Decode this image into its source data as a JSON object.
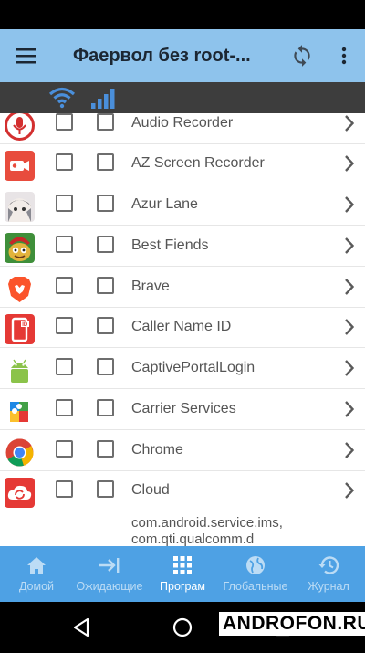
{
  "app_bar": {
    "title": "Фаервол без root-...",
    "menu_icon": "hamburger-icon",
    "refresh_icon": "refresh-icon",
    "more_icon": "more-vert-icon",
    "background": "#8ec3ec"
  },
  "filter_bar": {
    "wifi_icon": "wifi-icon",
    "mobile_icon": "cellular-signal-icon",
    "icon_color": "#4a8fdb"
  },
  "apps": [
    {
      "name": "Audio Recorder",
      "icon": "microphone-icon",
      "wifi": false,
      "mobile": false
    },
    {
      "name": "AZ Screen Recorder",
      "icon": "video-camera-icon",
      "wifi": false,
      "mobile": false
    },
    {
      "name": "Azur Lane",
      "icon": "anime-character-icon",
      "wifi": false,
      "mobile": false
    },
    {
      "name": "Best Fiends",
      "icon": "best-fiends-icon",
      "wifi": false,
      "mobile": false
    },
    {
      "name": "Brave",
      "icon": "brave-lion-icon",
      "wifi": false,
      "mobile": false
    },
    {
      "name": "Caller Name ID",
      "icon": "phone-id-icon",
      "wifi": false,
      "mobile": false
    },
    {
      "name": "CaptivePortalLogin",
      "icon": "android-robot-icon",
      "wifi": false,
      "mobile": false
    },
    {
      "name": "Carrier Services",
      "icon": "puzzle-icon",
      "wifi": false,
      "mobile": false
    },
    {
      "name": "Chrome",
      "icon": "chrome-icon",
      "wifi": false,
      "mobile": false
    },
    {
      "name": "Cloud",
      "icon": "cloud-sync-icon",
      "wifi": false,
      "mobile": false
    }
  ],
  "system_entry": {
    "line1": "com.android.service.ims,",
    "line2": "com.qti.qualcomm.d"
  },
  "bottom_nav": [
    {
      "label": "Домой",
      "icon": "home-icon",
      "active": false
    },
    {
      "label": "Ожидающие",
      "icon": "arrow-to-bar-icon",
      "active": false
    },
    {
      "label": "Програм",
      "icon": "grid-icon",
      "active": true
    },
    {
      "label": "Глобальные",
      "icon": "globe-icon",
      "active": false
    },
    {
      "label": "Журнал",
      "icon": "history-icon",
      "active": false
    }
  ],
  "watermark": "ANDROFON.RU"
}
